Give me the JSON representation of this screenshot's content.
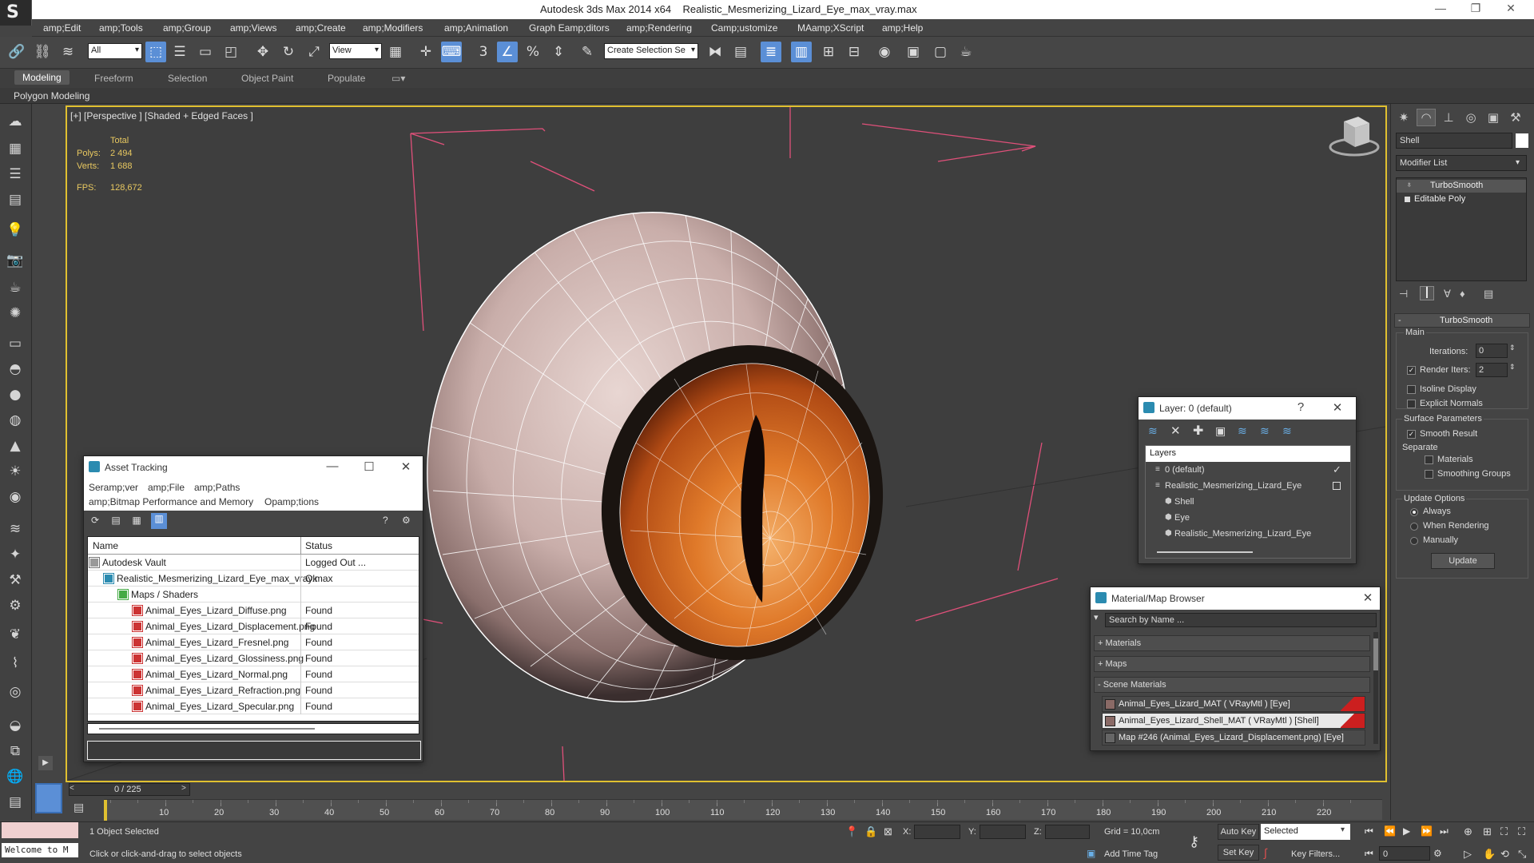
{
  "window": {
    "app_title": "Autodesk 3ds Max  2014 x64",
    "file_title": "Realistic_Mesmerizing_Lizard_Eye_max_vray.max"
  },
  "menu": [
    "amp;Edit",
    "amp;Tools",
    "amp;Group",
    "amp;Views",
    "amp;Create",
    "amp;Modifiers",
    "amp;Animation",
    "Graph Eamp;ditors",
    "amp;Rendering",
    "Camp;ustomize",
    "MAamp;XScript",
    "amp;Help"
  ],
  "toolbar": {
    "filter_value": "All",
    "refcoord_value": "View",
    "selection_set_placeholder": "Create Selection Se"
  },
  "ribbon": {
    "tabs": [
      "Modeling",
      "Freeform",
      "Selection",
      "Object Paint",
      "Populate"
    ],
    "subtitle": "Polygon Modeling"
  },
  "viewport": {
    "label": "[+] [Perspective ] [Shaded + Edged Faces ]",
    "stats": {
      "total_label": "Total",
      "polys_label": "Polys:",
      "polys_value": "2 494",
      "verts_label": "Verts:",
      "verts_value": "1 688",
      "fps_label": "FPS:",
      "fps_value": "128,672"
    }
  },
  "command_panel": {
    "object_name": "Shell",
    "modifier_list_label": "Modifier List",
    "stack": [
      "TurboSmooth",
      "Editable Poly"
    ],
    "rollout_title": "TurboSmooth",
    "main_label": "Main",
    "iterations_label": "Iterations:",
    "iterations_value": "0",
    "render_iters_label": "Render Iters:",
    "render_iters_value": "2",
    "isoline_label": "Isoline Display",
    "explicit_normals_label": "Explicit Normals",
    "surface_params_label": "Surface Parameters",
    "smooth_result_label": "Smooth Result",
    "separate_label": "Separate",
    "materials_label": "Materials",
    "smoothing_groups_label": "Smoothing Groups",
    "update_options_label": "Update Options",
    "always_label": "Always",
    "when_rendering_label": "When Rendering",
    "manually_label": "Manually",
    "update_button": "Update"
  },
  "asset_tracking": {
    "title": "Asset Tracking",
    "menu_row1": [
      "Seramp;ver",
      "amp;File",
      "amp;Paths"
    ],
    "menu_row2": [
      "amp;Bitmap Performance and Memory",
      "Opamp;tions"
    ],
    "col_name": "Name",
    "col_status": "Status",
    "rows": [
      {
        "name": "Autodesk Vault",
        "status": "Logged Out ..."
      },
      {
        "name": "Realistic_Mesmerizing_Lizard_Eye_max_vray.max",
        "status": "Ok"
      },
      {
        "name": "Maps / Shaders",
        "status": ""
      },
      {
        "name": "Animal_Eyes_Lizard_Diffuse.png",
        "status": "Found"
      },
      {
        "name": "Animal_Eyes_Lizard_Displacement.png",
        "status": "Found"
      },
      {
        "name": "Animal_Eyes_Lizard_Fresnel.png",
        "status": "Found"
      },
      {
        "name": "Animal_Eyes_Lizard_Glossiness.png",
        "status": "Found"
      },
      {
        "name": "Animal_Eyes_Lizard_Normal.png",
        "status": "Found"
      },
      {
        "name": "Animal_Eyes_Lizard_Refraction.png",
        "status": "Found"
      },
      {
        "name": "Animal_Eyes_Lizard_Specular.png",
        "status": "Found"
      }
    ]
  },
  "layer_window": {
    "title": "Layer: 0 (default)",
    "help": "?",
    "header": "Layers",
    "rows": [
      "0 (default)",
      "Realistic_Mesmerizing_Lizard_Eye",
      "Shell",
      "Eye",
      "Realistic_Mesmerizing_Lizard_Eye"
    ]
  },
  "material_browser": {
    "title": "Material/Map Browser",
    "search_placeholder": "Search by Name ...",
    "groups": [
      "+ Materials",
      "+ Maps",
      "- Scene Materials"
    ],
    "items": [
      "Animal_Eyes_Lizard_MAT  ( VRayMtl ) [Eye]",
      "Animal_Eyes_Lizard_Shell_MAT  ( VRayMtl ) [Shell]",
      "Map #246 (Animal_Eyes_Lizard_Displacement.png) [Eye]"
    ]
  },
  "timeline": {
    "frame_counter": "0 / 225",
    "ticks": [
      "10",
      "20",
      "30",
      "40",
      "50",
      "60",
      "70",
      "80",
      "90",
      "100",
      "110",
      "120",
      "130",
      "140",
      "150",
      "160",
      "170",
      "180",
      "190",
      "200",
      "210",
      "220"
    ]
  },
  "status": {
    "maxscript_label": "Welcome to M",
    "selection": "1 Object Selected",
    "prompt": "Click or click-and-drag to select objects",
    "x_label": "X:",
    "y_label": "Y:",
    "z_label": "Z:",
    "grid": "Grid = 10,0cm",
    "add_time_tag": "Add Time Tag",
    "auto_key": "Auto Key",
    "set_key": "Set Key",
    "selected_value": "Selected",
    "key_filters": "Key Filters...",
    "frame_value": "0"
  },
  "colors": {
    "accent_blue": "#5b8fd6",
    "viewport_border": "#e0c030",
    "stat_text": "#e8c860",
    "material_red": "#cc1f1f"
  }
}
